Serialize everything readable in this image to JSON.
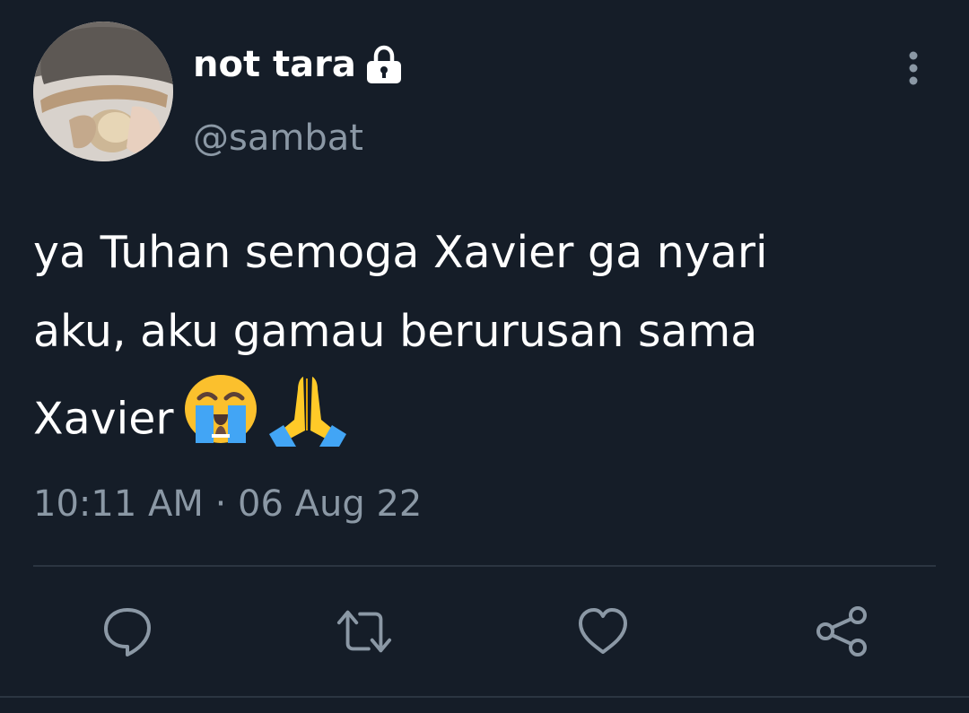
{
  "tweet": {
    "author": {
      "display_name": "not tara",
      "handle": "@sambat",
      "protected_icon": "lock-icon",
      "avatar_icon": "profile-photo"
    },
    "text_lines": [
      "ya Tuhan semoga Xavier ga nyari",
      "aku, aku gamau berurusan sama",
      "Xavier"
    ],
    "emojis": [
      "loudly-crying-face-emoji",
      "folded-hands-emoji"
    ],
    "time": "10:11 AM",
    "separator": "·",
    "date": "06 Aug 22"
  },
  "actions": [
    {
      "name": "reply",
      "icon": "reply-icon"
    },
    {
      "name": "retweet",
      "icon": "retweet-icon"
    },
    {
      "name": "like",
      "icon": "heart-icon"
    },
    {
      "name": "share",
      "icon": "share-icon"
    }
  ],
  "colors": {
    "background": "#151d28",
    "text_primary": "#ffffff",
    "text_secondary": "#8b98a5",
    "divider": "#2b3541"
  }
}
